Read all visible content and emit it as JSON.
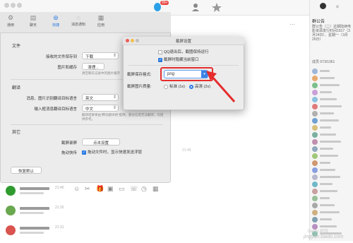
{
  "top": {
    "badge": "99+",
    "chat_title": "…"
  },
  "search": {
    "placeholder": ""
  },
  "tabs": [
    {
      "label": "通用"
    },
    {
      "label": "聊天"
    },
    {
      "label": "快捷"
    },
    {
      "label": "消息通知"
    },
    {
      "label": "应用"
    }
  ],
  "settings": {
    "file_section": "文件",
    "save_location_label": "接收的文件保存到",
    "save_location_value": "下载",
    "images_label": "图片和缓存",
    "clean_button": "清理...",
    "clean_hint": "清空聊天记录中的图片缓存",
    "translate_section": "翻译",
    "translate_target_label": "消息、图片识别翻译目标语言",
    "translate_target_value": "英文",
    "input_translate_label": "输入框消息翻译目标语言",
    "input_translate_value": "中文",
    "translate_hint": "翻译结果将由“腾讯翻译君”提供。部分信息无法翻译，仅提供参考。",
    "other_section": "其它",
    "screenshot_label": "截屏录屏",
    "screenshot_button": "点击设置",
    "drag_label": "拖动快传",
    "drag_checkbox": "拖动文件时，显示快速发送浮层",
    "restore_button": "恢复默认"
  },
  "capture_dialog": {
    "title": "截屏设置",
    "opt_hide_qq": "QQ退出后，截图保持运行",
    "opt_hide_window": "截屏时隐藏当前窗口",
    "format_label": "截屏保存格式:",
    "format_value": "png",
    "quality_label": "截屏图片质量:",
    "quality_standard": "标准 (1x)",
    "quality_hd": "高清 (2x)"
  },
  "group": {
    "title": "群公告",
    "notice": "群公告（二）近期陆续电影资源发行时间1917（3月24日）、星期一（3月26日）",
    "members_label": "成员 673/1361"
  },
  "chats": [
    {
      "time": "21:40"
    },
    {
      "time": "21:32"
    },
    {
      "time": "21:31"
    }
  ],
  "watermark": "jingyan.baidu.com",
  "watermark2": "Baidu 经验",
  "status_time": "21:45",
  "colors": {
    "accent": "#2a7ae2",
    "highlight": "#e52d2d"
  }
}
